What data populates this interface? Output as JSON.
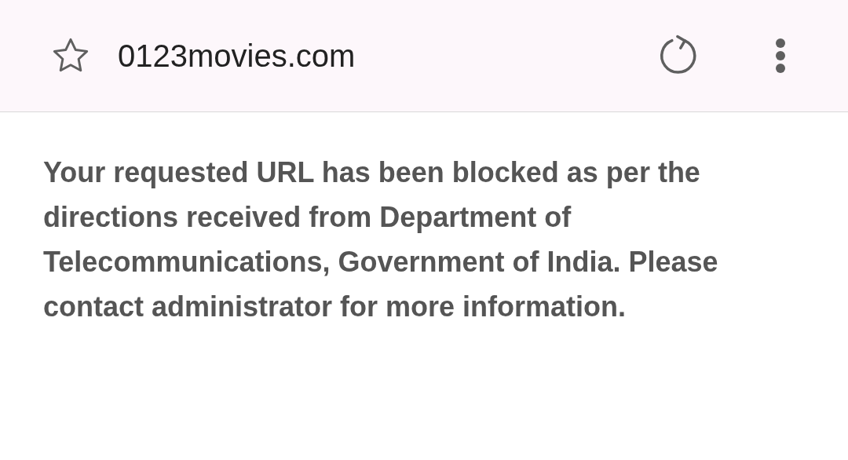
{
  "address_bar": {
    "url": "0123movies.com"
  },
  "message": "Your requested URL has been blocked as per the directions received from Department of Telecommunications, Government of India. Please contact administrator for more information."
}
